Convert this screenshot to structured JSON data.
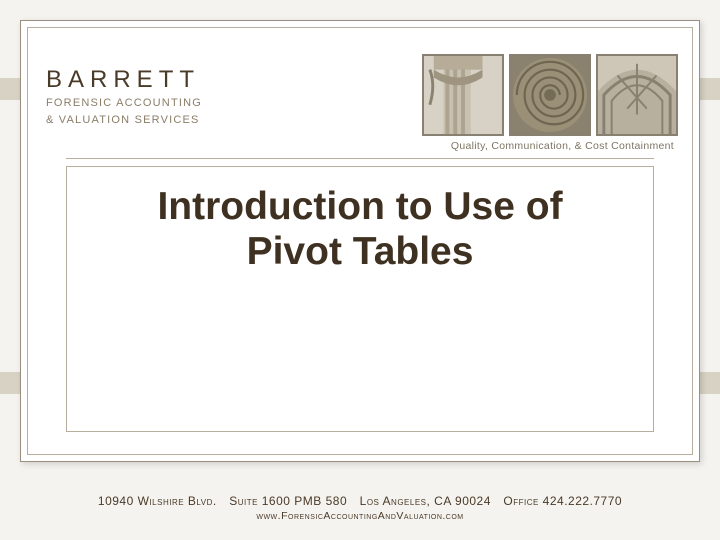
{
  "brand": {
    "name": "BARRETT",
    "sub1": "FORENSIC ACCOUNTING",
    "sub2": "& VALUATION SERVICES"
  },
  "tagline": "Quality, Communication, & Cost Containment",
  "slide": {
    "title_line1": "Introduction to Use of",
    "title_line2": "Pivot Tables"
  },
  "footer": {
    "line1": "10940 Wilshire Blvd. Suite 1600 PMB 580 Los Angeles, CA 90024 Office 424.222.7770",
    "line2": "www.ForensicAccountingAndValuation.com"
  }
}
